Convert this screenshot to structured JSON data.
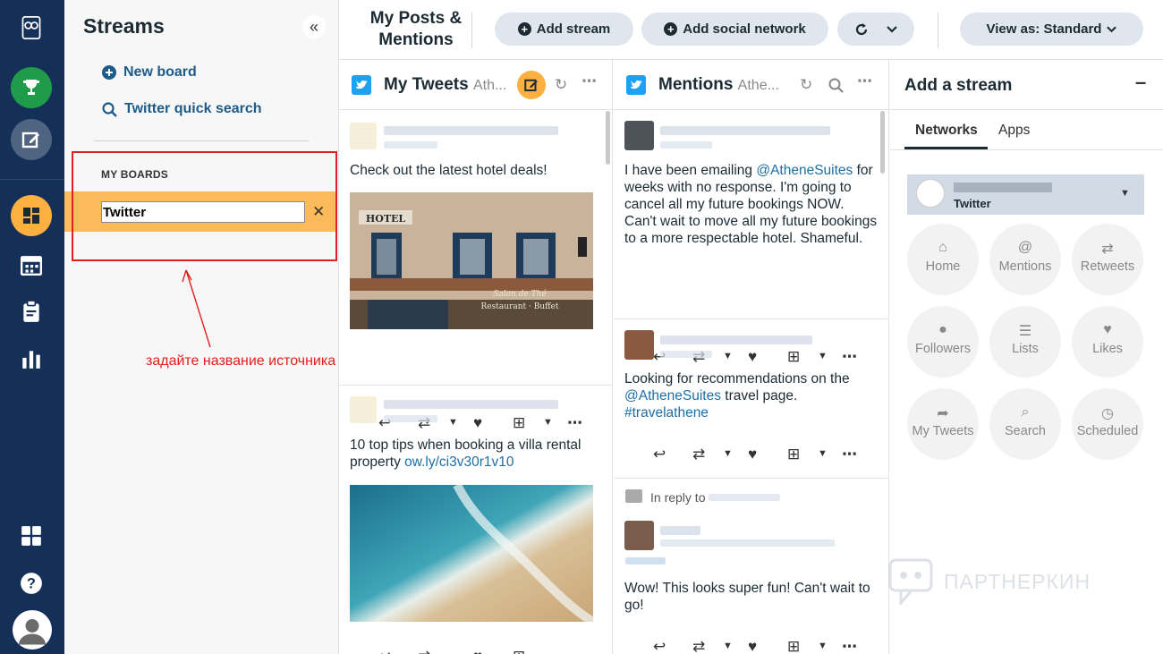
{
  "streams_panel": {
    "title": "Streams",
    "collapse_icon": "«",
    "new_board": "New board",
    "quick_search": "Twitter quick search",
    "my_boards_label": "MY BOARDS",
    "board_input_value": "Twitter",
    "close_icon": "✕",
    "annotation": "задайте название источника"
  },
  "topbar": {
    "title": "My Posts & Mentions",
    "add_stream": "Add stream",
    "add_social": "Add social network",
    "view_as": "View as: Standard"
  },
  "tweets_col": {
    "title": "My Tweets",
    "subtitle": "Ath...",
    "post1_text": "Check out the latest hotel deals!",
    "post2_text": "10 top tips when booking a villa rental property ",
    "post2_link": "ow.ly/ci3v30r1v10",
    "hotel_sign": "HOTEL",
    "shop_sign_1": "Salon de Thé",
    "shop_sign_2": "Restaurant · Buffet"
  },
  "mentions_col": {
    "title": "Mentions",
    "subtitle": "Athe...",
    "post1_pre": "I have been emailing ",
    "post1_mention": "@AtheneSuites",
    "post1_post": " for weeks with no response. I'm going to cancel all my future bookings NOW. Can't wait to move all my future bookings to a more respectable hotel. Shameful.",
    "post2_pre": "Looking for recommendations on the ",
    "post2_mention": "@AtheneSuites",
    "post2_post": " travel page. ",
    "post2_tag": "#travelathene",
    "reply_label": "In reply to ",
    "post3_text": "Wow! This looks super fun! Can't wait to go!"
  },
  "add_stream": {
    "title": "Add a stream",
    "minimize": "–",
    "tab_networks": "Networks",
    "tab_apps": "Apps",
    "account_network": "Twitter",
    "types": [
      "Home",
      "Mentions",
      "Retweets",
      "Followers",
      "Lists",
      "Likes",
      "My Tweets",
      "Search",
      "Scheduled"
    ]
  },
  "watermark": "ПАРТНЕРКИН",
  "colors": {
    "rail": "#143059",
    "accent": "#fbb040",
    "link": "#1d6fa5",
    "annotation": "#e02020"
  }
}
